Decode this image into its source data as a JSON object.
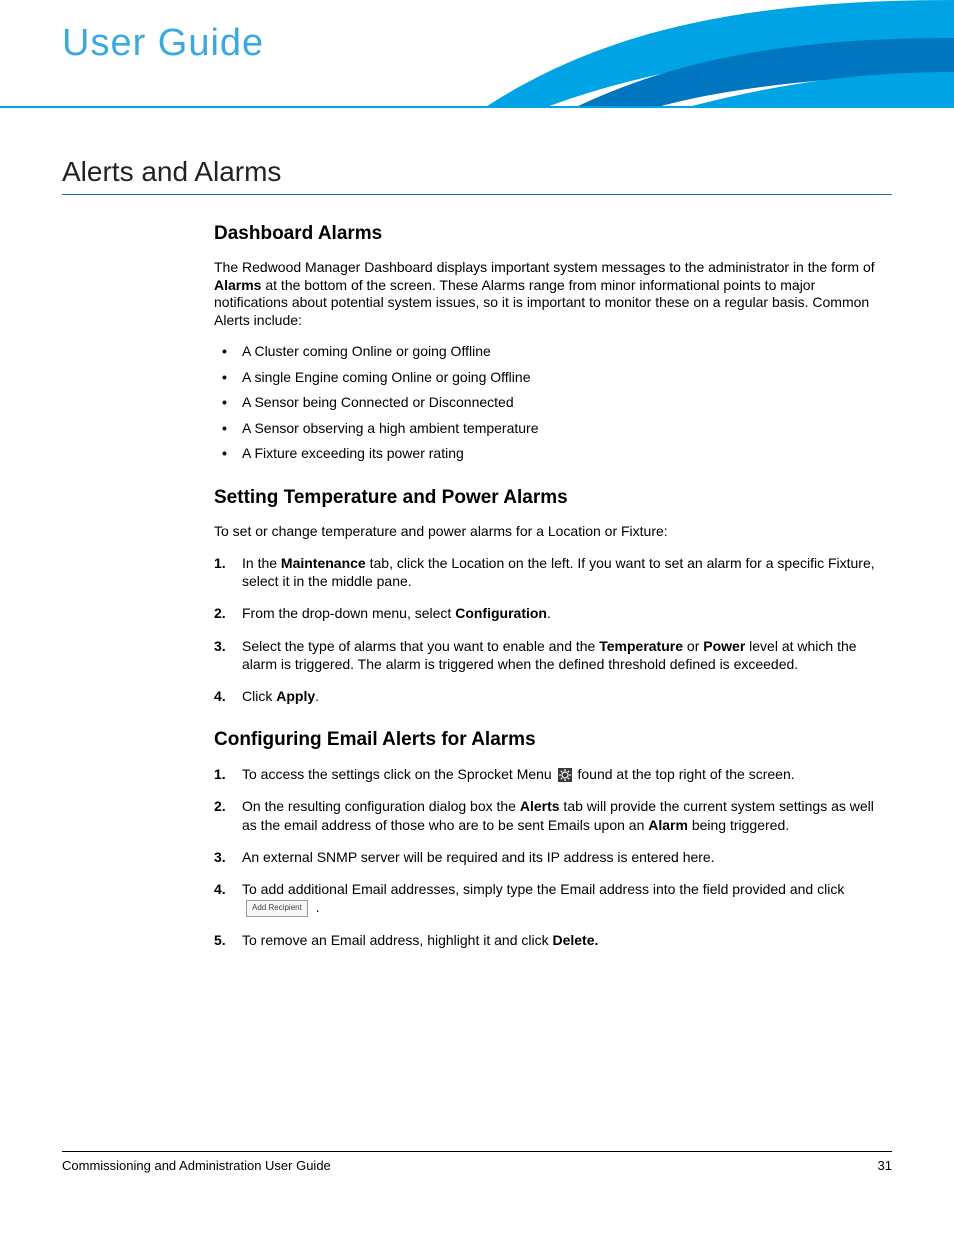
{
  "header": {
    "title": "User Guide"
  },
  "page": {
    "h1": "Alerts and Alarms",
    "section1": {
      "heading": "Dashboard Alarms",
      "intro_pre": "The Redwood Manager Dashboard displays important system messages to the administrator in the form of ",
      "intro_bold": "Alarms",
      "intro_post": " at the bottom of the screen. These Alarms range from minor informational points to major notifications about potential system issues, so it is important to monitor these on a regular basis. Common Alerts include:",
      "bullets": [
        "A Cluster coming Online or going Offline",
        "A single Engine coming Online or going Offline",
        "A Sensor being Connected or Disconnected",
        "A Sensor observing a high ambient temperature",
        "A Fixture exceeding its power rating"
      ]
    },
    "section2": {
      "heading": "Setting Temperature and Power Alarms",
      "intro": "To set or change temperature and power alarms for a Location or Fixture:",
      "steps": {
        "s1_pre": "In the ",
        "s1_b1": "Maintenance",
        "s1_post": " tab, click the Location on the left. If you want to set an alarm for a specific Fixture, select it in the middle pane.",
        "s2_pre": "From the drop-down menu, select ",
        "s2_b1": "Configuration",
        "s2_post": ".",
        "s3_pre": "Select the type of alarms that you want to enable and the ",
        "s3_b1": "Temperature",
        "s3_mid": " or ",
        "s3_b2": "Power",
        "s3_post": " level at which the alarm is triggered. The alarm is triggered when the defined threshold defined is exceeded.",
        "s4_pre": "Click ",
        "s4_b1": "Apply",
        "s4_post": "."
      }
    },
    "section3": {
      "heading": "Configuring Email Alerts for Alarms",
      "steps": {
        "s1_pre": "To access the settings click on the Sprocket Menu ",
        "s1_post": " found at the top right of the screen.",
        "s2_pre": "On the resulting configuration dialog box the ",
        "s2_b1": "Alerts",
        "s2_mid": " tab will provide the current system settings as well as the email address of those who are to be sent Emails upon an ",
        "s2_b2": "Alarm",
        "s2_post": " being triggered.",
        "s3": "An external SNMP server will be required and its IP address is entered here.",
        "s4_pre": "To add additional Email addresses, simply type the Email address into the field provided and click ",
        "s4_button": "Add Recipient",
        "s4_post": " .",
        "s5_pre": "To remove an Email address, highlight it and click ",
        "s5_b1": "Delete.",
        "s5_post": ""
      }
    }
  },
  "footer": {
    "left": "Commissioning and Administration User Guide",
    "right": "31"
  }
}
